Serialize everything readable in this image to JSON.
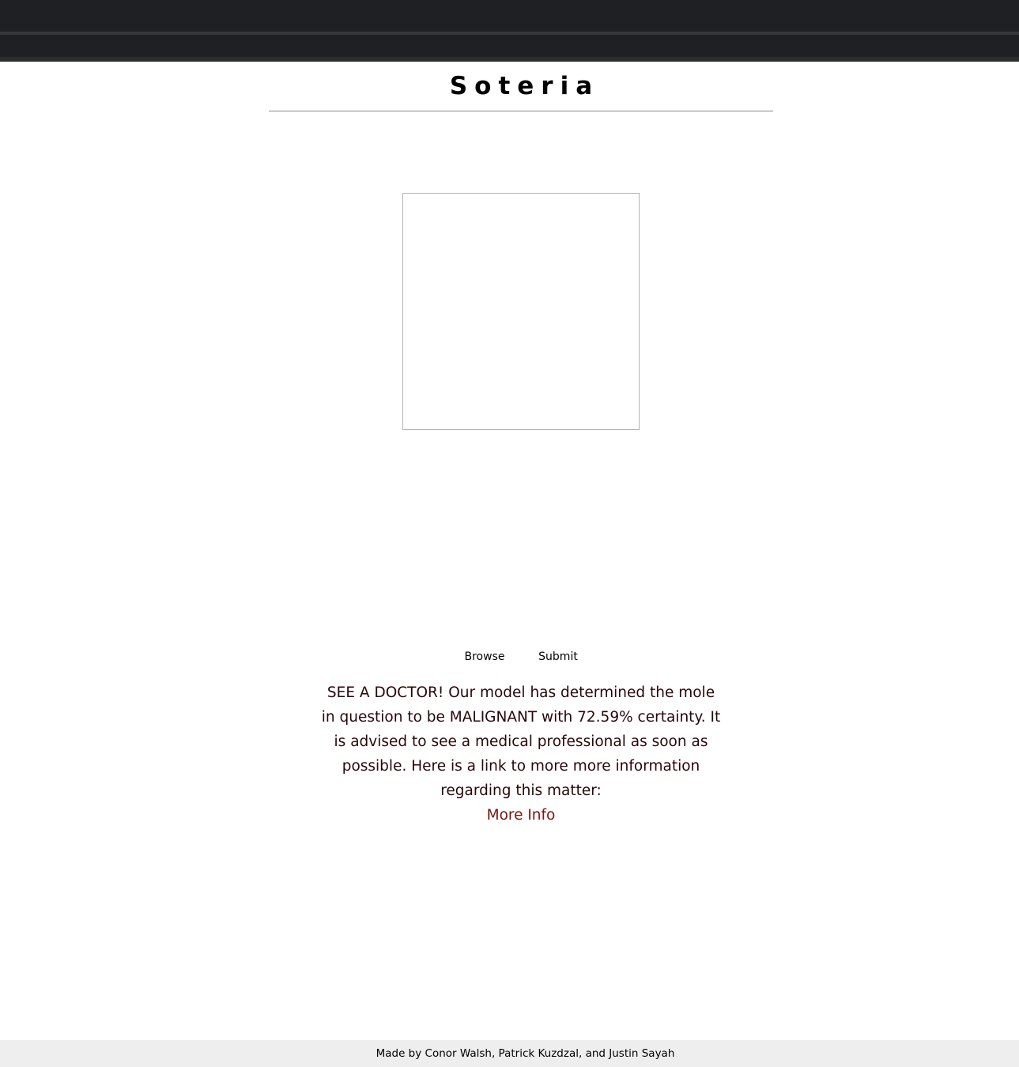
{
  "header": {
    "title": "Soteria"
  },
  "actions": {
    "browse_label": "Browse",
    "submit_label": "Submit"
  },
  "result": {
    "message": "SEE A DOCTOR! Our model has determined the mole in question to be MALIGNANT with 72.59% certainty. It is advised to see a medical professional as soon as possible. Here is a link to more more information regarding this matter:",
    "link_label": "More Info"
  },
  "footer": {
    "credits": "Made by Conor Walsh, Patrick Kuzdzal, and Justin Sayah"
  },
  "colors": {
    "chrome_bg": "#1f2023",
    "result_text": "#2a0608",
    "link_text": "#7a1410",
    "footer_bg": "#eeeeee"
  }
}
